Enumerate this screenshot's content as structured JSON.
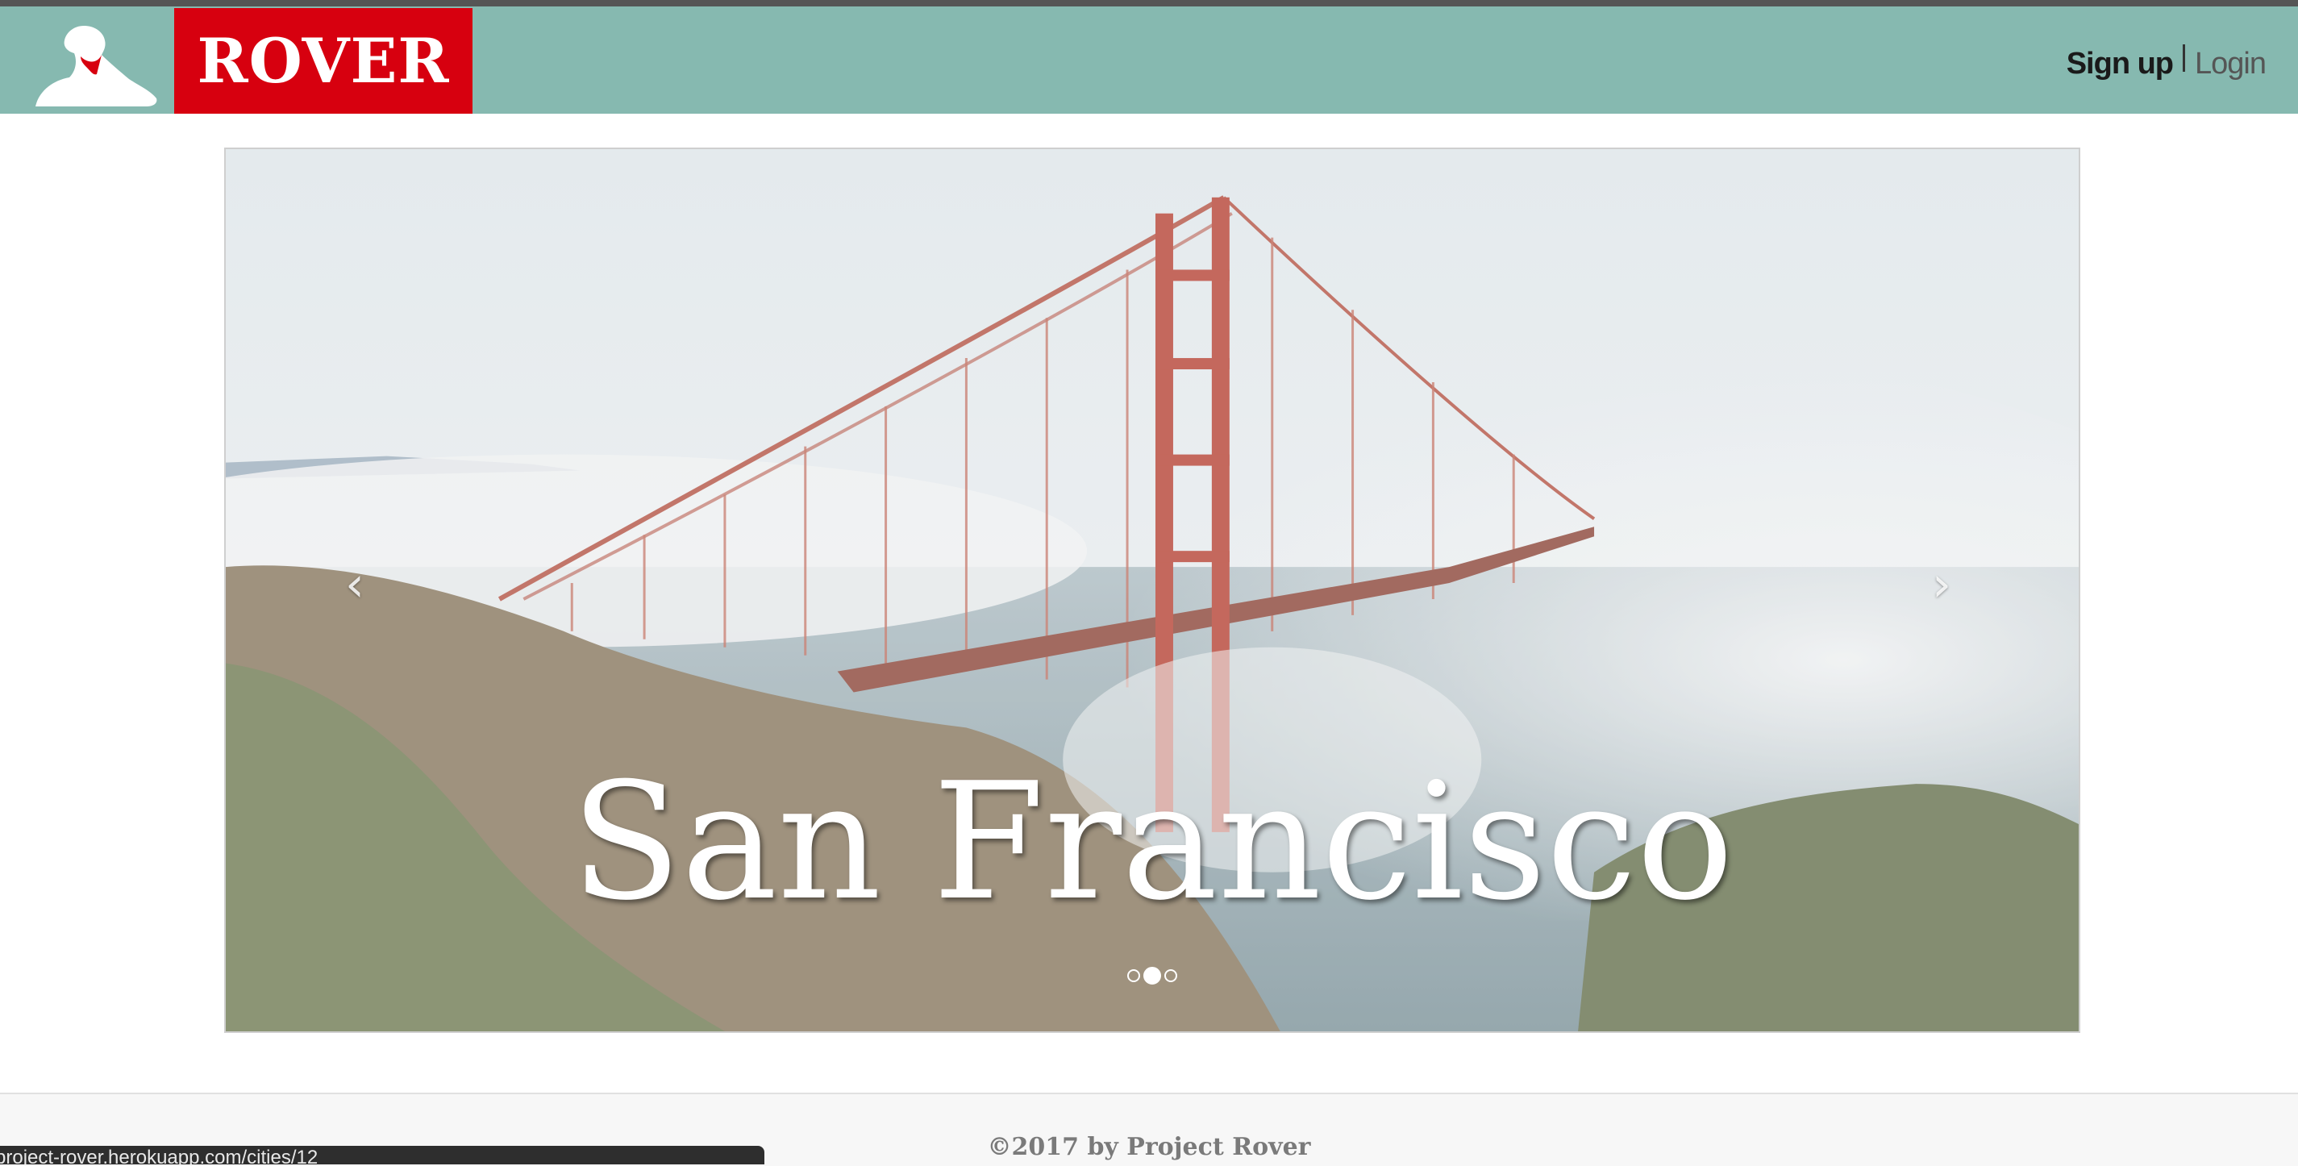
{
  "header": {
    "logo_icon": "dog-logo-icon",
    "brand": "ROVER",
    "nav": {
      "signup_label": "Sign up",
      "login_label": "Login"
    },
    "colors": {
      "navbar": "#86b9b0",
      "brand_box": "#d7000f"
    }
  },
  "carousel": {
    "caption": "San Francisco",
    "prev_icon": "chevron-left-icon",
    "next_icon": "chevron-right-icon",
    "indicator_count": 3,
    "active_index": 1,
    "prev_glyph": "‹",
    "next_glyph": "›"
  },
  "footer": {
    "text": "©2017 by Project Rover"
  },
  "status_bar": {
    "url": "project-rover.herokuapp.com/cities/12"
  }
}
